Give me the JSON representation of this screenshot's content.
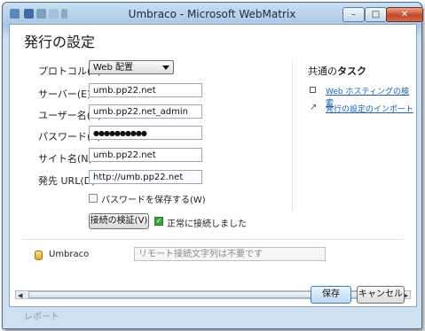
{
  "window": {
    "title": "Umbraco - Microsoft WebMatrix",
    "minimize": "–",
    "maximize": "□",
    "close": "✕"
  },
  "dialog": {
    "heading": "発行の設定",
    "protocol": {
      "label": "プロトコル(R):",
      "value": "Web 配置"
    },
    "server": {
      "label": "サーバー(E):",
      "value": "umb.pp22.net"
    },
    "username": {
      "label": "ユーザー名(U):",
      "value": "umb.pp22.net_admin"
    },
    "password": {
      "label": "パスワード(S):",
      "value": "●●●●●●●●●●"
    },
    "sitename": {
      "label": "サイト名(N):",
      "value": "umb.pp22.net"
    },
    "dest_url": {
      "label": "発先 URL(D):",
      "value": "http://umb.pp22.net"
    },
    "save_password_label": "パスワードを保存する(W)",
    "validate_button": "接続の検証(V)",
    "connection_status": "正常に接続しました",
    "database": {
      "name": "Umbraco",
      "placeholder": "リモート接続文字列は不要です"
    },
    "save_button": "保存",
    "cancel_button": "キャンセル"
  },
  "tasks": {
    "title_prefix": "共通の",
    "title_bold": "タスク",
    "items": [
      {
        "label": "Web ホスティングの検索"
      },
      {
        "label": "発行の設定のインポート"
      }
    ]
  },
  "background": {
    "report_label": "レポート"
  },
  "colors": {
    "link": "#1b5fae",
    "success_check": "#3aa53a"
  }
}
